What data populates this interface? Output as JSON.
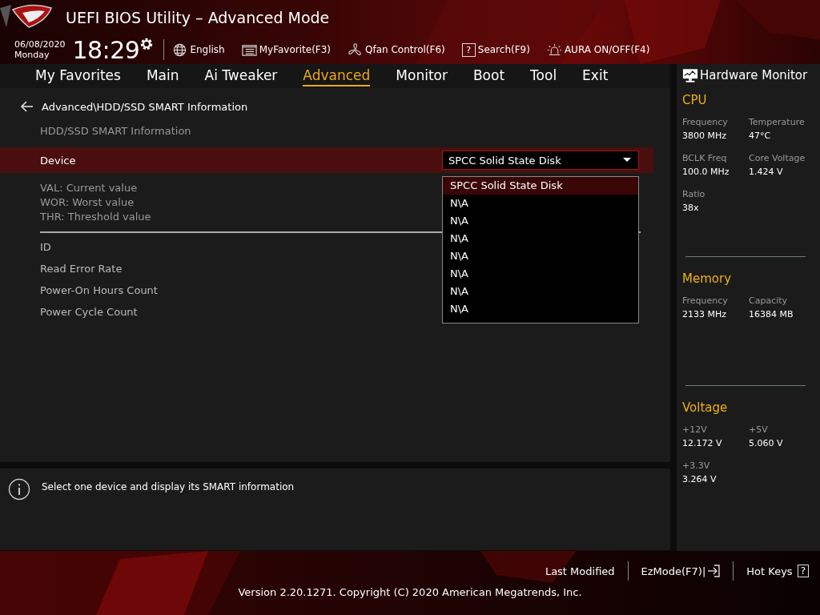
{
  "header": {
    "title": "UEFI BIOS Utility – Advanced Mode",
    "date": "06/08/2020",
    "day": "Monday",
    "time": "18:29",
    "tools": [
      {
        "kind": "globe",
        "label": "English"
      },
      {
        "kind": "favorite",
        "label": "MyFavorite(F3)"
      },
      {
        "kind": "fan",
        "label": "Qfan Control(F6)"
      },
      {
        "kind": "search",
        "glyph": "?",
        "label": "Search(F9)"
      },
      {
        "kind": "aura",
        "label": "AURA ON/OFF(F4)"
      }
    ]
  },
  "tabs": [
    {
      "label": "My Favorites",
      "selected": false
    },
    {
      "label": "Main",
      "selected": false
    },
    {
      "label": "Ai Tweaker",
      "selected": false
    },
    {
      "label": "Advanced",
      "selected": true
    },
    {
      "label": "Monitor",
      "selected": false
    },
    {
      "label": "Boot",
      "selected": false
    },
    {
      "label": "Tool",
      "selected": false
    },
    {
      "label": "Exit",
      "selected": false
    }
  ],
  "breadcrumb": "Advanced\\HDD/SSD SMART Information",
  "section_title": "HDD/SSD SMART Information",
  "device": {
    "label": "Device",
    "value": "SPCC Solid State Disk",
    "options": [
      {
        "label": "SPCC Solid State Disk",
        "selected": true
      },
      {
        "label": "N\\A",
        "selected": false
      },
      {
        "label": "N\\A",
        "selected": false
      },
      {
        "label": "N\\A",
        "selected": false
      },
      {
        "label": "N\\A",
        "selected": false
      },
      {
        "label": "N\\A",
        "selected": false
      },
      {
        "label": "N\\A",
        "selected": false
      },
      {
        "label": "N\\A",
        "selected": false
      }
    ]
  },
  "legend": [
    "VAL:  Current value",
    "WOR: Worst value",
    "THR:  Threshold value"
  ],
  "attributes": [
    "ID",
    "Read Error Rate",
    "Power-On Hours Count",
    "Power Cycle Count"
  ],
  "help": "Select one device and display its SMART information",
  "hardware_monitor": {
    "title": "Hardware Monitor",
    "sections": [
      {
        "title": "CPU",
        "items": [
          {
            "label": "Frequency",
            "value": "3800 MHz"
          },
          {
            "label": "Temperature",
            "value": "47°C"
          },
          {
            "label": "BCLK Freq",
            "value": "100.0 MHz"
          },
          {
            "label": "Core Voltage",
            "value": "1.424 V"
          },
          {
            "label": "Ratio",
            "value": "38x"
          }
        ]
      },
      {
        "title": "Memory",
        "items": [
          {
            "label": "Frequency",
            "value": "2133 MHz"
          },
          {
            "label": "Capacity",
            "value": "16384 MB"
          }
        ]
      },
      {
        "title": "Voltage",
        "items": [
          {
            "label": "+12V",
            "value": "12.172 V"
          },
          {
            "label": "+5V",
            "value": "5.060 V"
          },
          {
            "label": "+3.3V",
            "value": "3.264 V"
          }
        ]
      }
    ]
  },
  "footer": {
    "last_modified": "Last Modified",
    "ezmode": "EzMode(F7)|",
    "hotkeys": "Hot Keys",
    "hotkeys_glyph": "?",
    "version": "Version 2.20.1271. Copyright (C) 2020 American Megatrends, Inc."
  }
}
